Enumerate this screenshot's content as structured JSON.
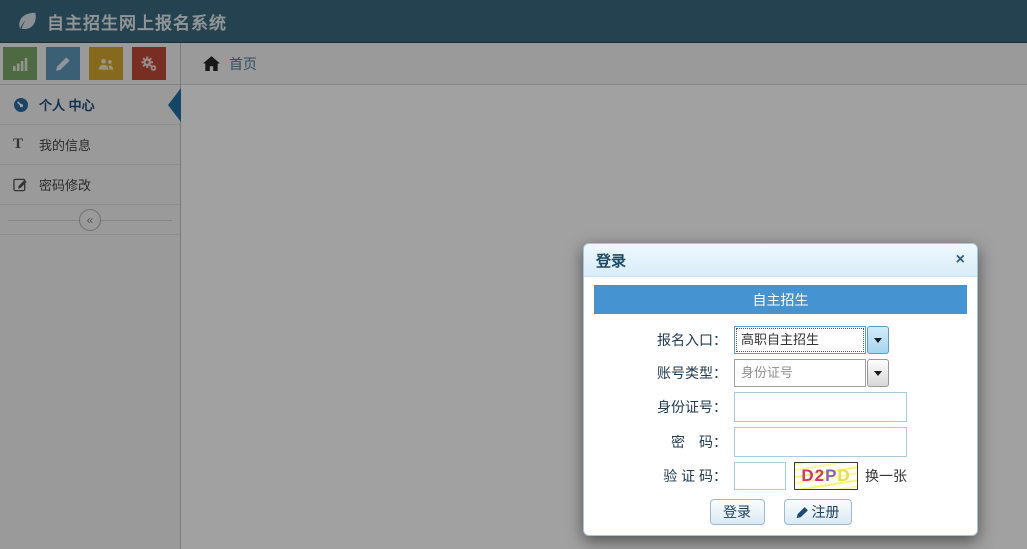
{
  "header": {
    "title": "自主招生网上报名系统"
  },
  "sidebar": {
    "quick_buttons": [
      {
        "name": "stats",
        "icon": "bar-chart-icon",
        "color": "#7ca96a"
      },
      {
        "name": "edit",
        "icon": "pencil-icon",
        "color": "#5e97ba"
      },
      {
        "name": "users",
        "icon": "users-icon",
        "color": "#d6a62f"
      },
      {
        "name": "settings",
        "icon": "gears-icon",
        "color": "#c04a3a"
      }
    ],
    "menu": [
      {
        "label": "个人 中心",
        "active": true
      },
      {
        "label": "我的信息",
        "active": false
      },
      {
        "label": "密码修改",
        "active": false
      }
    ],
    "collapse_glyph": "«"
  },
  "breadcrumb": {
    "home": "首页"
  },
  "modal": {
    "title": "登录",
    "close_glyph": "×",
    "banner": "自主招生",
    "fields": {
      "entry": {
        "label": "报名入口：",
        "value": "高职自主招生"
      },
      "account_type": {
        "label": "账号类型：",
        "value": "身份证号"
      },
      "id_number": {
        "label": "身份证号：",
        "value": ""
      },
      "password": {
        "label": "密　码：",
        "value": ""
      },
      "captcha": {
        "label": "验 证 码：",
        "value": "",
        "refresh": "换一张",
        "chars": [
          {
            "ch": "D",
            "color": "#d4356a"
          },
          {
            "ch": "2",
            "color": "#d4356a"
          },
          {
            "ch": "P",
            "color": "#8a5fc0"
          },
          {
            "ch": "D",
            "color": "#e6dc55"
          }
        ]
      }
    },
    "buttons": {
      "login": "登录",
      "register": "注册"
    }
  },
  "colors": {
    "header_bg": "#3a697e",
    "banner": "#4693d2",
    "active_marker": "#2470a0"
  }
}
